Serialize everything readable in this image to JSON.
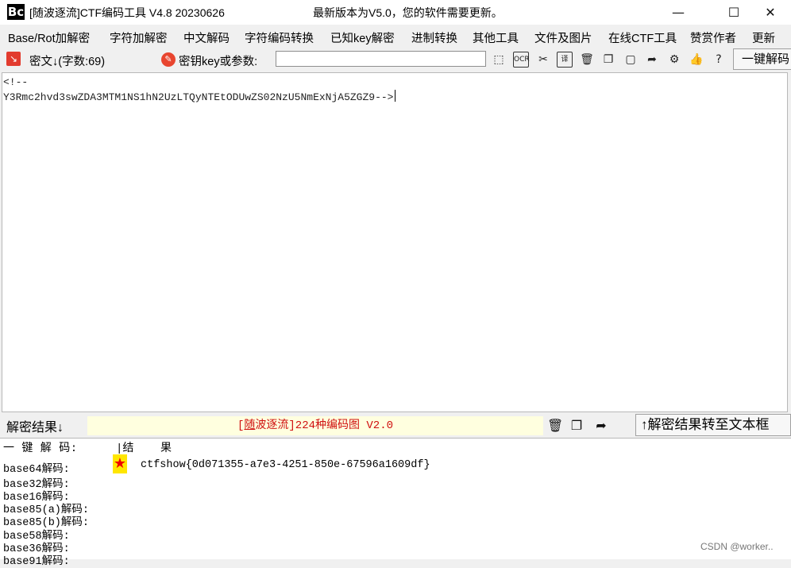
{
  "window": {
    "logo": "Bc",
    "title": "[随波逐流]CTF编码工具 V4.8 20230626",
    "update_notice": "最新版本为V5.0，您的软件需要更新。",
    "minimize": "—",
    "maximize": "☐",
    "close": "✕"
  },
  "menu": [
    "Base/Rot加解密",
    "字符加解密",
    "中文解码",
    "字符编码转换",
    "已知key解密",
    "进制转换",
    "其他工具",
    "文件及图片",
    "在线CTF工具",
    "赞赏作者",
    "更新"
  ],
  "toolbar": {
    "cipher_label": "密文↓(字数:69)",
    "key_label": "密钥key或参数:",
    "key_value": "",
    "one_click_decode": "一键解码"
  },
  "icons": {
    "cipher": "cipher-icon",
    "key": "key-icon",
    "tools": [
      "cursor-select-icon",
      "ocr-icon",
      "scissors-icon",
      "translate-icon",
      "trash-icon",
      "copy-icon",
      "paste-icon",
      "share-icon",
      "gear-icon",
      "thumbs-up-icon",
      "help-icon"
    ]
  },
  "cipher_text": {
    "line1": "<!--",
    "line2": "Y3Rmc2hvd3swZDA3MTM1NS1hN2UzLTQyNTEtODUwZS02NzU5NmExNjA5ZGZ9-->"
  },
  "result_bar": {
    "label": "解密结果↓",
    "banner_prefix": "[",
    "banner_highlight": "随",
    "banner_rest": "波逐流]224种编码图 V2.0",
    "to_textbox": "↑解密结果转至文本框"
  },
  "results": {
    "header_left": "一 键 解 码:",
    "header_right": "|结    果",
    "rows": [
      "base64解码:",
      "base32解码:",
      "base16解码:",
      "base85(a)解码:",
      "base85(b)解码:",
      "base58解码:",
      "base36解码:",
      "base91解码:"
    ],
    "star": "★",
    "flag": "ctfshow{0d071355-a7e3-4251-850e-67596a1609df}"
  },
  "watermark": "CSDN @worker.."
}
